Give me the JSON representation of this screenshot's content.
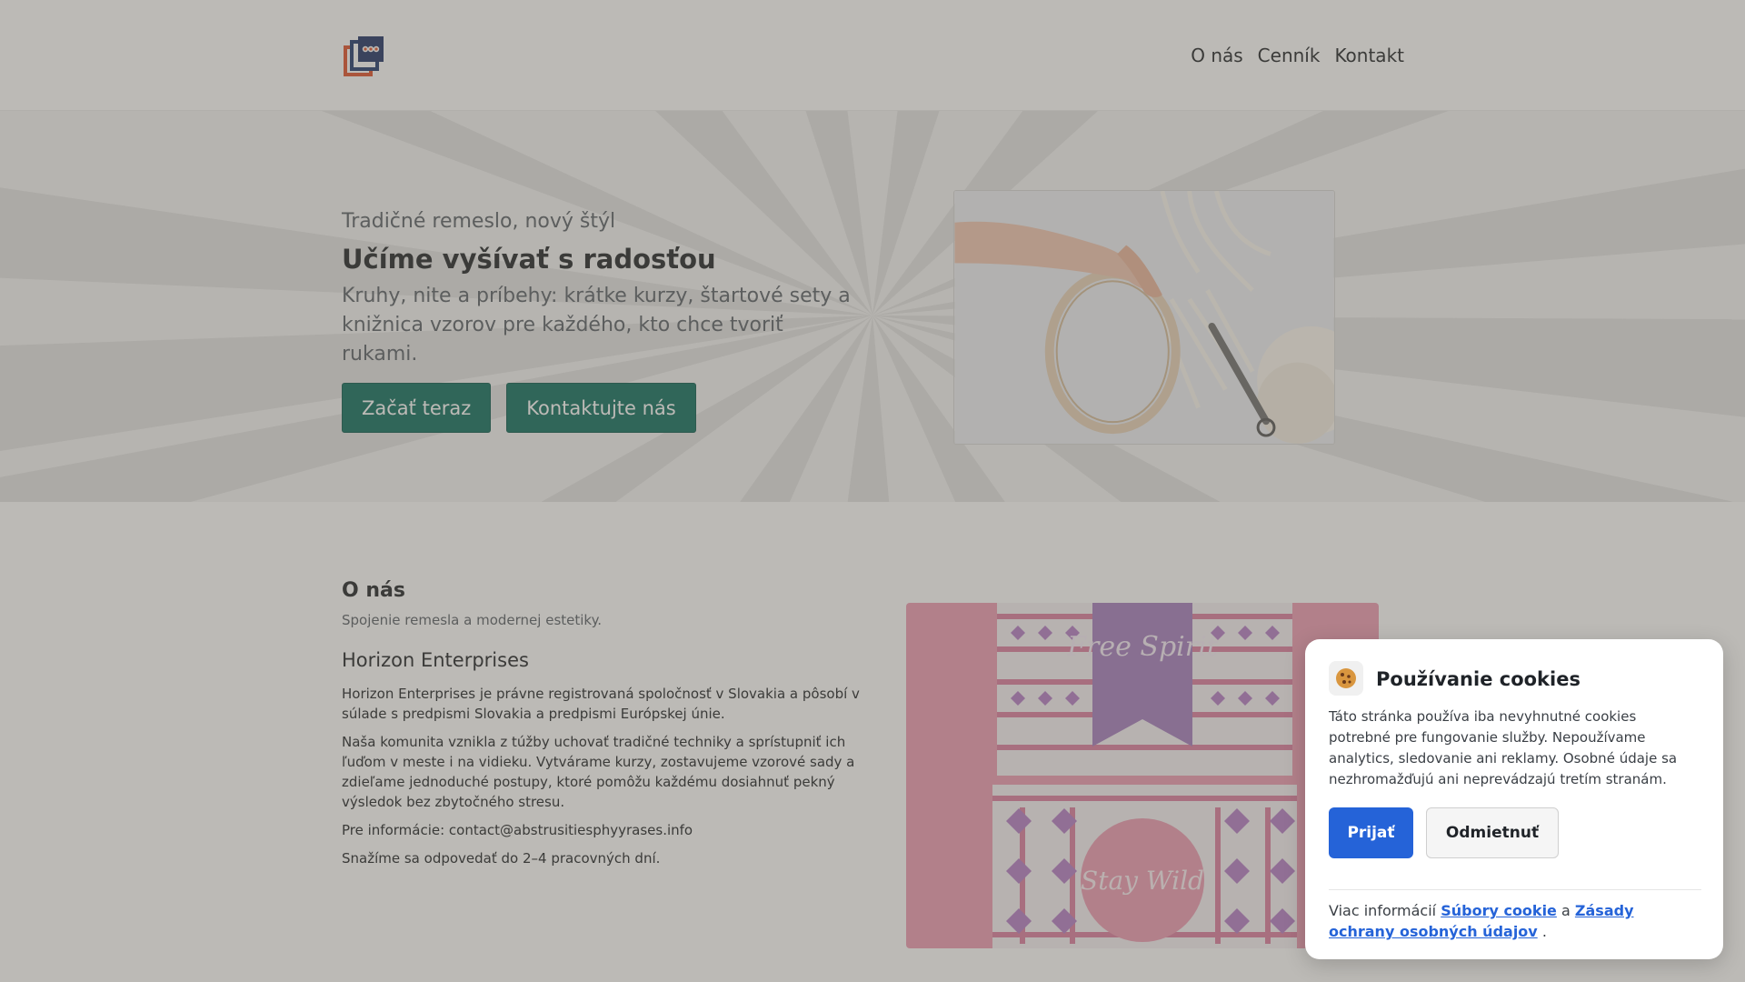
{
  "header": {
    "logo_icon": "brand-logo-icon",
    "nav": [
      {
        "label": "O nás"
      },
      {
        "label": "Cenník"
      },
      {
        "label": "Kontakt"
      }
    ]
  },
  "hero": {
    "kicker": "Tradičné remeslo, nový štýl",
    "title": "Učíme vyšívať s radosťou",
    "lead": "Kruhy, nite a príbehy: krátke kurzy, štartové sety a knižnica vzorov pre každého, kto chce tvoriť rukami.",
    "primary_button": "Začať teraz",
    "secondary_button": "Kontaktujte nás",
    "button_color": "#0f6e5f"
  },
  "about": {
    "title": "O nás",
    "subtitle": "Spojenie remesla a modernej estetiky.",
    "company": "Horizon Enterprises",
    "paragraphs": [
      "Horizon Enterprises je právne registrovaná spoločnosť v Slovakia a pôsobí v súlade s predpismi Slovakia a predpismi Európskej únie.",
      "Naša komunita vznikla z túžby uchovať tradičné techniky a sprístupniť ich ľuďom v meste i na vidieku. Vytvárame kurzy, zostavujeme vzorové sady a zdieľame jednoduché postupy, ktoré pomôžu každému dosiahnuť pekný výsledok bez zbytočného stresu.",
      "Pre informácie: contact@abstrusitiesphyyrases.info",
      "Snažíme sa odpovedať do 2–4 pracovných dní."
    ],
    "image_text_top": "Free Spirit",
    "image_text_bottom": "Stay Wild"
  },
  "cookie": {
    "icon": "cookie-icon",
    "title": "Používanie cookies",
    "description": "Táto stránka používa iba nevyhnutné cookies potrebné pre fungovanie služby. Nepoužívame analytics, sledovanie ani reklamy. Osobné údaje sa nezhromažďujú ani neprevádzajú tretím stranám.",
    "accept": "Prijať",
    "reject": "Odmietnuť",
    "more_prefix": "Viac informácií",
    "link_cookies": "Súbory cookie",
    "and": "a",
    "link_privacy": "Zásady ochrany osobných údajov",
    "period": ".",
    "accent": "#2563d8"
  }
}
